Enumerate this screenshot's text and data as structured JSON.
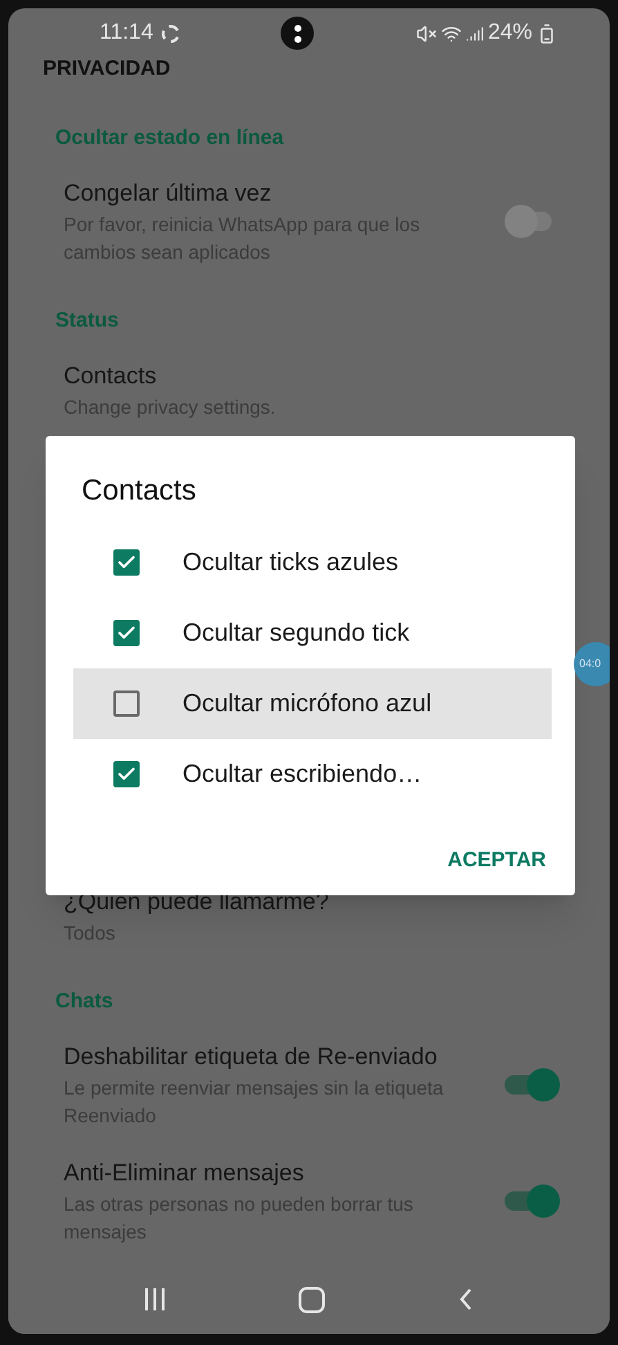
{
  "status_bar": {
    "time": "11:14",
    "battery": "24%"
  },
  "title": "PRIVACIDAD",
  "sections": [
    {
      "header": "Ocultar estado en línea",
      "items": [
        {
          "kind": "switch",
          "title": "Congelar última vez",
          "subtitle": "Por favor, reinicia WhatsApp para que los cambios sean aplicados",
          "on": false
        }
      ]
    },
    {
      "header": "Status",
      "items": [
        {
          "kind": "plain",
          "title": "Contacts",
          "subtitle": "Change privacy settings."
        }
      ]
    },
    {
      "items": [
        {
          "kind": "plain",
          "title": "¿Quien puede llamarme?",
          "subtitle": "Todos"
        }
      ]
    },
    {
      "header": "Chats",
      "items": [
        {
          "kind": "switch",
          "title": "Deshabilitar etiqueta de Re-enviado",
          "subtitle": "Le permite reenviar mensajes sin la etiqueta Reenviado",
          "on": true
        },
        {
          "kind": "switch",
          "title": "Anti-Eliminar mensajes",
          "subtitle": "Las otras personas no pueden borrar tus mensajes",
          "on": true
        }
      ]
    }
  ],
  "dialog": {
    "title": "Contacts",
    "options": [
      {
        "label": "Ocultar ticks azules",
        "checked": true,
        "highlighted": false
      },
      {
        "label": "Ocultar segundo tick",
        "checked": true,
        "highlighted": false
      },
      {
        "label": "Ocultar micrófono azul",
        "checked": false,
        "highlighted": true
      },
      {
        "label": "Ocultar escribiendo…",
        "checked": true,
        "highlighted": false
      }
    ],
    "button": "ACEPTAR"
  },
  "bubble": {
    "text": "04:0"
  }
}
